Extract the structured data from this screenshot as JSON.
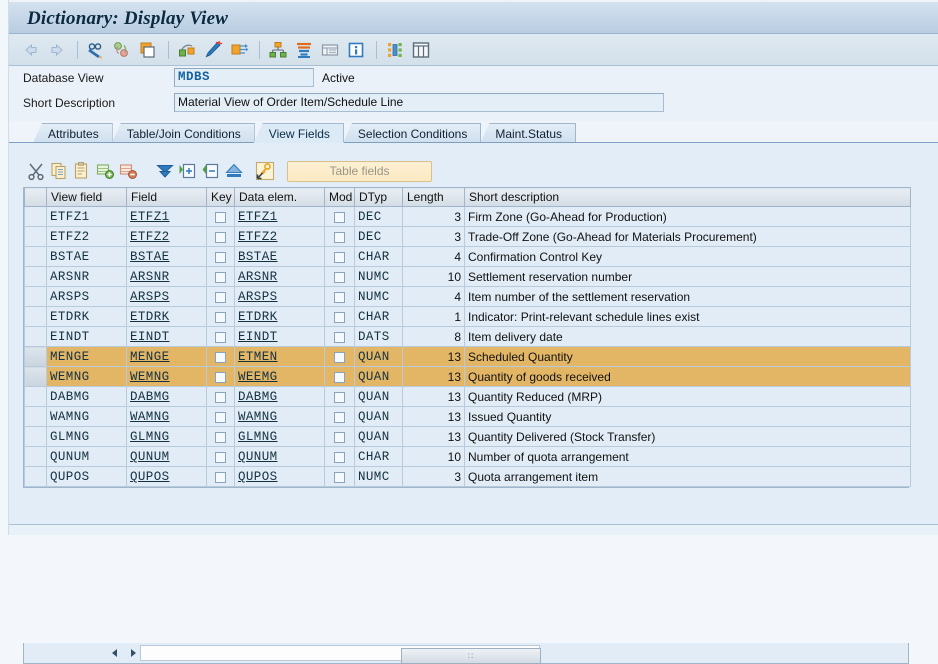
{
  "window": {
    "title": "Dictionary: Display View"
  },
  "main_toolbar": {
    "buttons": [
      {
        "name": "back-icon",
        "label": "Back"
      },
      {
        "name": "forward-icon",
        "label": "Forward"
      },
      {
        "name": "display-change-icon",
        "label": "Display <-> Change"
      },
      {
        "name": "other-view-icon",
        "label": "Other view"
      },
      {
        "name": "copy-object-icon",
        "label": "Copy"
      },
      {
        "name": "revise-icon",
        "label": "Revised version"
      },
      {
        "name": "activate-icon",
        "label": "Activate"
      },
      {
        "name": "activation-log-icon",
        "label": "Activation log"
      },
      {
        "name": "hierarchy-icon",
        "label": "Where-used list"
      },
      {
        "name": "stack-icon",
        "label": "Database object"
      },
      {
        "name": "table-contents-icon",
        "label": "Contents"
      },
      {
        "name": "info-icon",
        "label": "Information"
      },
      {
        "name": "runtime-object-icon",
        "label": "Runtime object"
      },
      {
        "name": "grid-icon",
        "label": "Table view"
      }
    ]
  },
  "form": {
    "database_view_label": "Database View",
    "database_view_value": "MDBS",
    "status": "Active",
    "short_description_label": "Short Description",
    "short_description_value": "Material View of Order Item/Schedule Line"
  },
  "tabs": [
    {
      "label": "Attributes",
      "active": false
    },
    {
      "label": "Table/Join Conditions",
      "active": false
    },
    {
      "label": "View Fields",
      "active": true
    },
    {
      "label": "Selection Conditions",
      "active": false
    },
    {
      "label": "Maint.Status",
      "active": false
    }
  ],
  "sub_toolbar": {
    "buttons": [
      {
        "name": "cut-icon",
        "label": "Cut"
      },
      {
        "name": "copy-icon",
        "label": "Copy"
      },
      {
        "name": "paste-icon",
        "label": "Paste"
      },
      {
        "name": "insert-row-icon",
        "label": "Insert row"
      },
      {
        "name": "delete-row-icon",
        "label": "Delete row"
      },
      {
        "name": "sort-down-icon",
        "label": "Sort"
      },
      {
        "name": "expand-icon",
        "label": "Expand"
      },
      {
        "name": "collapse-icon",
        "label": "Collapse"
      },
      {
        "name": "top-icon",
        "label": "Scroll to top"
      },
      {
        "name": "key-fields-icon",
        "label": "Key fields"
      }
    ],
    "table_fields_label": "Table fields"
  },
  "grid": {
    "columns": [
      "View field",
      "Field",
      "Key",
      "Data elem.",
      "Mod",
      "DTyp",
      "Length",
      "Short description"
    ],
    "rows": [
      {
        "view_field": "ETFZ1",
        "field": "ETFZ1",
        "key": false,
        "data_elem": "ETFZ1",
        "mod": false,
        "dtyp": "DEC",
        "length": "3",
        "short_description": "Firm Zone (Go-Ahead for Production)",
        "highlighted": false
      },
      {
        "view_field": "ETFZ2",
        "field": "ETFZ2",
        "key": false,
        "data_elem": "ETFZ2",
        "mod": false,
        "dtyp": "DEC",
        "length": "3",
        "short_description": "Trade-Off Zone (Go-Ahead for Materials Procurement)",
        "highlighted": false
      },
      {
        "view_field": "BSTAE",
        "field": "BSTAE",
        "key": false,
        "data_elem": "BSTAE",
        "mod": false,
        "dtyp": "CHAR",
        "length": "4",
        "short_description": "Confirmation Control Key",
        "highlighted": false
      },
      {
        "view_field": "ARSNR",
        "field": "ARSNR",
        "key": false,
        "data_elem": "ARSNR",
        "mod": false,
        "dtyp": "NUMC",
        "length": "10",
        "short_description": "Settlement reservation number",
        "highlighted": false
      },
      {
        "view_field": "ARSPS",
        "field": "ARSPS",
        "key": false,
        "data_elem": "ARSPS",
        "mod": false,
        "dtyp": "NUMC",
        "length": "4",
        "short_description": "Item number of the settlement reservation",
        "highlighted": false
      },
      {
        "view_field": "ETDRK",
        "field": "ETDRK",
        "key": false,
        "data_elem": "ETDRK",
        "mod": false,
        "dtyp": "CHAR",
        "length": "1",
        "short_description": "Indicator: Print-relevant schedule lines exist",
        "highlighted": false
      },
      {
        "view_field": "EINDT",
        "field": "EINDT",
        "key": false,
        "data_elem": "EINDT",
        "mod": false,
        "dtyp": "DATS",
        "length": "8",
        "short_description": "Item delivery date",
        "highlighted": false
      },
      {
        "view_field": "MENGE",
        "field": "MENGE",
        "key": false,
        "data_elem": "ETMEN",
        "mod": false,
        "dtyp": "QUAN",
        "length": "13",
        "short_description": "Scheduled Quantity",
        "highlighted": true
      },
      {
        "view_field": "WEMNG",
        "field": "WEMNG",
        "key": false,
        "data_elem": "WEEMG",
        "mod": false,
        "dtyp": "QUAN",
        "length": "13",
        "short_description": "Quantity of goods received",
        "highlighted": true
      },
      {
        "view_field": "DABMG",
        "field": "DABMG",
        "key": false,
        "data_elem": "DABMG",
        "mod": false,
        "dtyp": "QUAN",
        "length": "13",
        "short_description": "Quantity Reduced (MRP)",
        "highlighted": false
      },
      {
        "view_field": "WAMNG",
        "field": "WAMNG",
        "key": false,
        "data_elem": "WAMNG",
        "mod": false,
        "dtyp": "QUAN",
        "length": "13",
        "short_description": "Issued Quantity",
        "highlighted": false
      },
      {
        "view_field": "GLMNG",
        "field": "GLMNG",
        "key": false,
        "data_elem": "GLMNG",
        "mod": false,
        "dtyp": "QUAN",
        "length": "13",
        "short_description": "Quantity Delivered (Stock Transfer)",
        "highlighted": false
      },
      {
        "view_field": "QUNUM",
        "field": "QUNUM",
        "key": false,
        "data_elem": "QUNUM",
        "mod": false,
        "dtyp": "CHAR",
        "length": "10",
        "short_description": "Number of quota arrangement",
        "highlighted": false
      },
      {
        "view_field": "QUPOS",
        "field": "QUPOS",
        "key": false,
        "data_elem": "QUPOS",
        "mod": false,
        "dtyp": "NUMC",
        "length": "3",
        "short_description": "Quota arrangement item",
        "highlighted": false
      }
    ]
  },
  "scrollbar": {
    "left_arrow": "◀",
    "right_arrow": "▶",
    "grip": "∶∶"
  },
  "colors": {
    "highlight_row": "#e3b666",
    "title_text": "#0a2a3f",
    "field_value": "#1463a0",
    "grid_row": "#e1ecf6"
  }
}
